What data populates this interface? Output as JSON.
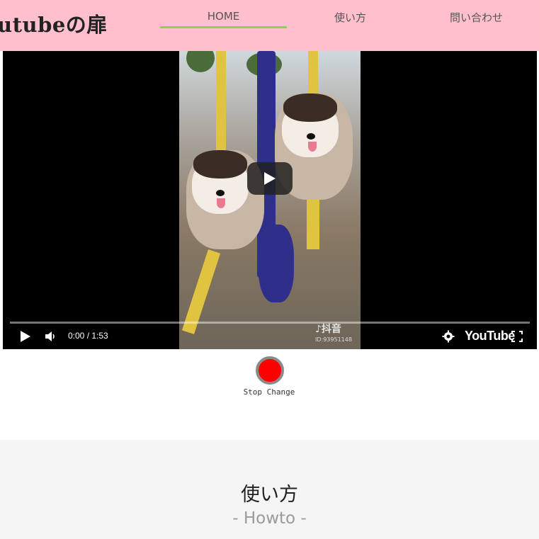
{
  "header": {
    "logo": "utubeの扉",
    "nav": [
      {
        "label": "HOME",
        "active": true
      },
      {
        "label": "使い方",
        "active": false
      },
      {
        "label": "問い合わせ",
        "active": false
      }
    ],
    "background": "#ffbfcc",
    "active_underline_color": "#7ed957"
  },
  "video": {
    "time_display": "0:00 / 1:53",
    "watermark": "♪抖音",
    "watermark_id": "ID:93951148",
    "platform_logo": "YouTube",
    "controls": [
      "play-icon",
      "volume-icon",
      "settings-gear-icon",
      "fullscreen-icon"
    ]
  },
  "stop_change": {
    "label": "Stop Change",
    "button_color": "#ff0000"
  },
  "howto": {
    "title": "使い方",
    "subtitle": "- Howto -"
  }
}
